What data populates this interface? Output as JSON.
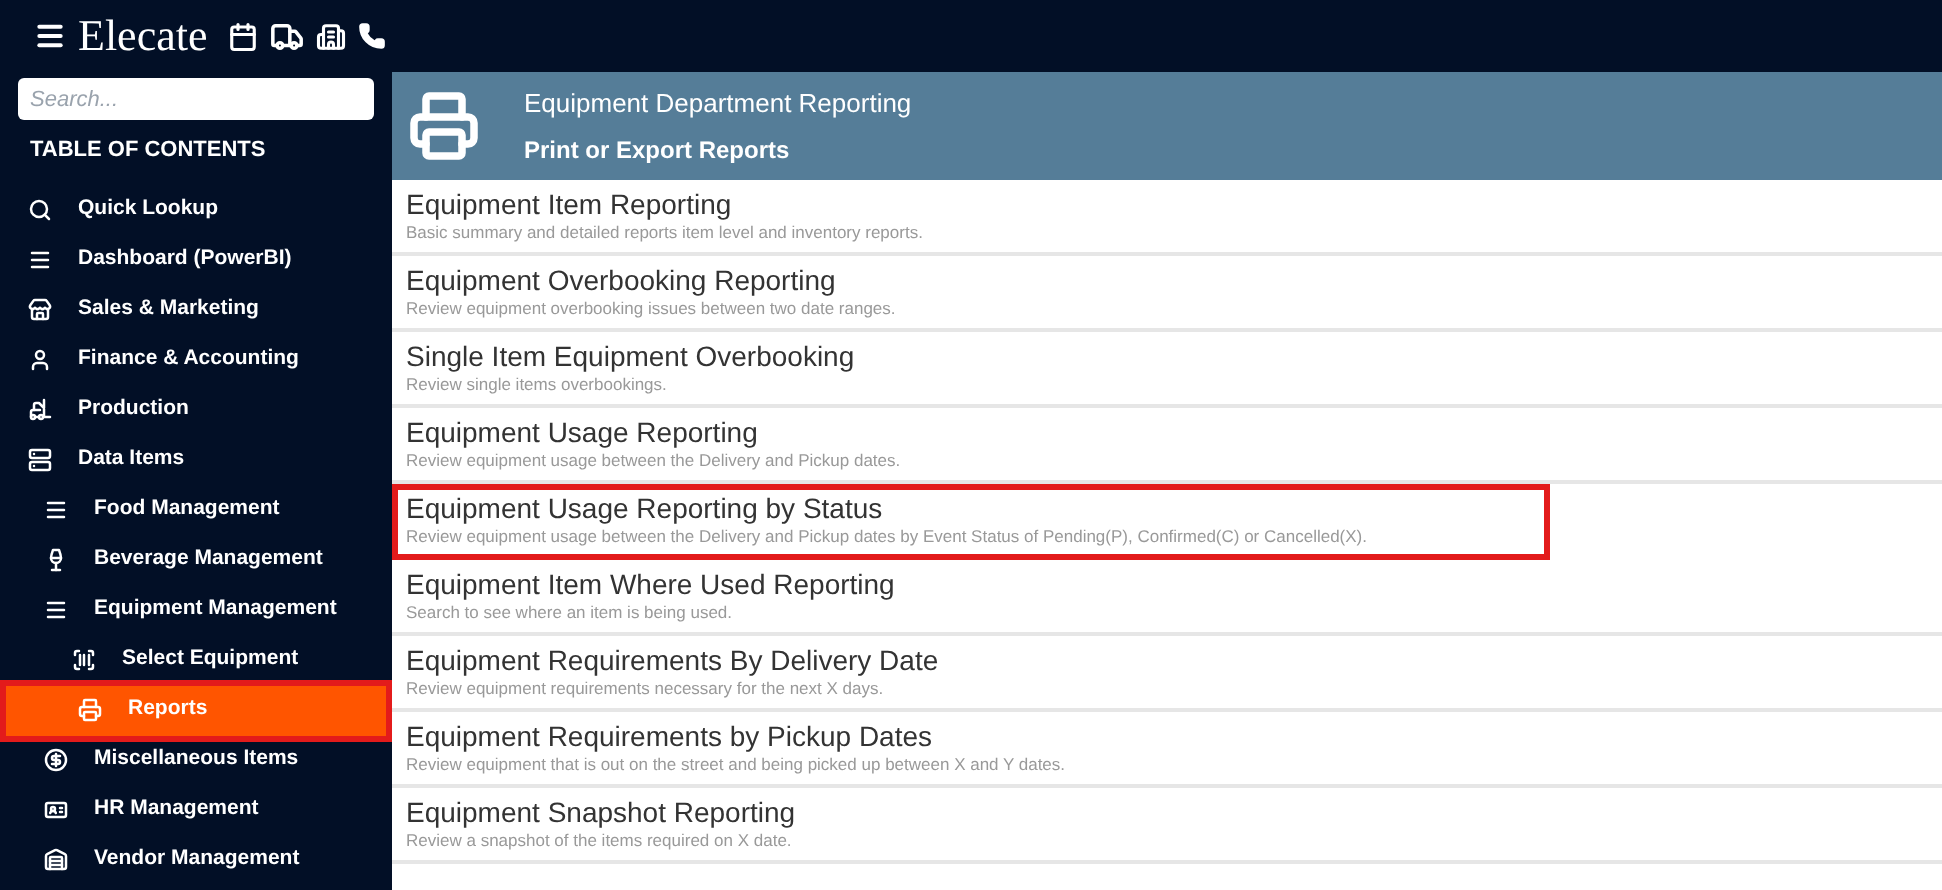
{
  "header": {
    "logo": "Elecate"
  },
  "sidebar": {
    "search": {
      "placeholder": "Search..."
    },
    "heading": "TABLE OF CONTENTS",
    "items": [
      {
        "label": "Quick Lookup",
        "selected": false,
        "annotated": false
      },
      {
        "label": "Dashboard (PowerBI)",
        "selected": false,
        "annotated": false
      },
      {
        "label": "Sales & Marketing",
        "selected": false,
        "annotated": false
      },
      {
        "label": "Finance & Accounting",
        "selected": false,
        "annotated": false
      },
      {
        "label": "Production",
        "selected": false,
        "annotated": false
      },
      {
        "label": "Data Items",
        "selected": false,
        "annotated": false,
        "children": [
          {
            "label": "Food Management",
            "selected": false,
            "annotated": false
          },
          {
            "label": "Beverage Management",
            "selected": false,
            "annotated": false
          },
          {
            "label": "Equipment Management",
            "selected": false,
            "annotated": false,
            "children": [
              {
                "label": "Select Equipment",
                "selected": false,
                "annotated": false
              },
              {
                "label": "Reports",
                "selected": true,
                "annotated": true
              }
            ]
          },
          {
            "label": "Miscellaneous Items",
            "selected": false,
            "annotated": false
          },
          {
            "label": "HR Management",
            "selected": false,
            "annotated": false
          },
          {
            "label": "Vendor Management",
            "selected": false,
            "annotated": false
          }
        ]
      }
    ]
  },
  "panel": {
    "title": "Equipment Department Reporting",
    "subtitle": "Print or Export Reports",
    "reports": [
      {
        "title": "Equipment Item Reporting",
        "description": "Basic summary and detailed reports item level and inventory reports.",
        "annotated": false
      },
      {
        "title": "Equipment Overbooking Reporting",
        "description": "Review equipment overbooking issues between two date ranges.",
        "annotated": false
      },
      {
        "title": "Single Item Equipment Overbooking",
        "description": "Review single items overbookings.",
        "annotated": false
      },
      {
        "title": "Equipment Usage Reporting",
        "description": "Review equipment usage between the Delivery and Pickup dates.",
        "annotated": false
      },
      {
        "title": "Equipment Usage Reporting by Status",
        "description": "Review equipment usage between the Delivery and Pickup dates by Event Status of Pending(P), Confirmed(C) or Cancelled(X).",
        "annotated": true
      },
      {
        "title": "Equipment Item Where Used Reporting",
        "description": "Search to see where an item is being used.",
        "annotated": false
      },
      {
        "title": "Equipment Requirements By Delivery Date",
        "description": "Review equipment requirements necessary for the next X days.",
        "annotated": false
      },
      {
        "title": "Equipment Requirements by Pickup Dates",
        "description": "Review equipment that is out on the street and being picked up between X and Y dates.",
        "annotated": false
      },
      {
        "title": "Equipment Snapshot Reporting",
        "description": "Review a snapshot of the items required on X date.",
        "annotated": false
      }
    ]
  }
}
